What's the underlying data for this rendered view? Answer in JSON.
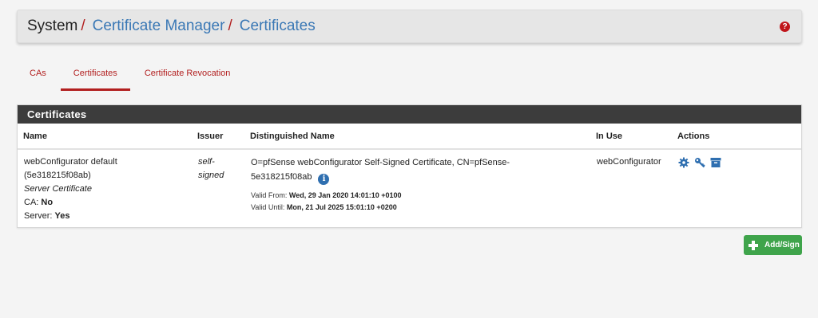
{
  "breadcrumb": {
    "root": "System",
    "separator": "/",
    "items": [
      "Certificate Manager",
      "Certificates"
    ]
  },
  "help_icon": "?",
  "tabs": [
    {
      "label": "CAs",
      "active": false
    },
    {
      "label": "Certificates",
      "active": true
    },
    {
      "label": "Certificate Revocation",
      "active": false
    }
  ],
  "panel": {
    "title": "Certificates",
    "columns": [
      "Name",
      "Issuer",
      "Distinguished Name",
      "In Use",
      "Actions"
    ],
    "rows": [
      {
        "name": "webConfigurator default",
        "name_id": "(5e318215f08ab)",
        "type": "Server Certificate",
        "ca_label": "CA:",
        "ca_value": "No",
        "server_label": "Server:",
        "server_value": "Yes",
        "issuer_line1": "self-",
        "issuer_line2": "signed",
        "dn_line1": "O=pfSense webConfigurator Self-Signed Certificate, CN=pfSense-",
        "dn_line2": "5e318215f08ab",
        "valid_from_label": "Valid From:",
        "valid_from": "Wed, 29 Jan 2020 14:01:10 +0100",
        "valid_until_label": "Valid Until:",
        "valid_until": "Mon, 21 Jul 2025 15:01:10 +0200",
        "in_use": "webConfigurator",
        "actions": [
          "gear-icon",
          "key-icon",
          "archive-icon"
        ]
      }
    ]
  },
  "add_button": {
    "label": "Add/Sign"
  },
  "colors": {
    "accent": "#b21f1f",
    "link": "#3a78b5",
    "panel_heading": "#3c3c3c",
    "success": "#3fa44b",
    "icon_blue": "#2f6fb0"
  }
}
